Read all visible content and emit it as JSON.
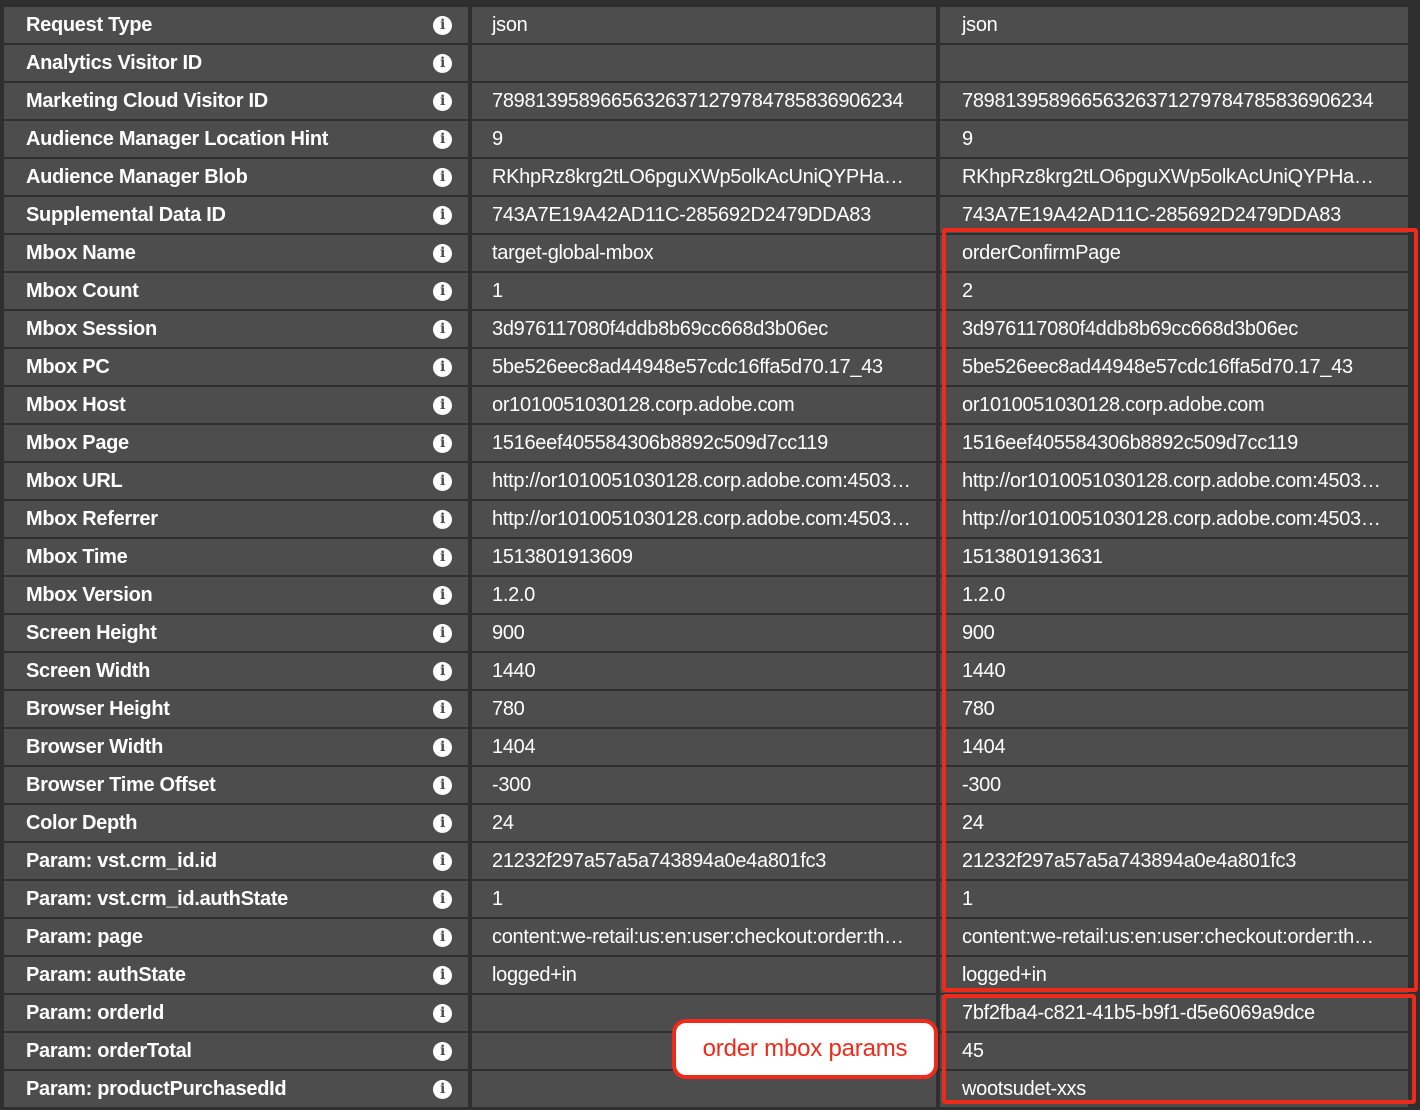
{
  "rows": [
    {
      "label": "Request Type",
      "value1": "json",
      "value2": "json"
    },
    {
      "label": "Analytics Visitor ID",
      "value1": "",
      "value2": ""
    },
    {
      "label": "Marketing Cloud Visitor ID",
      "value1": "78981395896656326371279784785836906234",
      "value2": "78981395896656326371279784785836906234"
    },
    {
      "label": "Audience Manager Location Hint",
      "value1": "9",
      "value2": "9"
    },
    {
      "label": "Audience Manager Blob",
      "value1": "RKhpRz8krg2tLO6pguXWp5olkAcUniQYPHa…",
      "value2": "RKhpRz8krg2tLO6pguXWp5olkAcUniQYPHa…"
    },
    {
      "label": "Supplemental Data ID",
      "value1": "743A7E19A42AD11C-285692D2479DDA83",
      "value2": "743A7E19A42AD11C-285692D2479DDA83"
    },
    {
      "label": "Mbox Name",
      "value1": "target-global-mbox",
      "value2": "orderConfirmPage"
    },
    {
      "label": "Mbox Count",
      "value1": "1",
      "value2": "2"
    },
    {
      "label": "Mbox Session",
      "value1": "3d976117080f4ddb8b69cc668d3b06ec",
      "value2": "3d976117080f4ddb8b69cc668d3b06ec"
    },
    {
      "label": "Mbox PC",
      "value1": "5be526eec8ad44948e57cdc16ffa5d70.17_43",
      "value2": "5be526eec8ad44948e57cdc16ffa5d70.17_43"
    },
    {
      "label": "Mbox Host",
      "value1": "or1010051030128.corp.adobe.com",
      "value2": "or1010051030128.corp.adobe.com"
    },
    {
      "label": "Mbox Page",
      "value1": "1516eef405584306b8892c509d7cc119",
      "value2": "1516eef405584306b8892c509d7cc119"
    },
    {
      "label": "Mbox URL",
      "value1": "http://or1010051030128.corp.adobe.com:4503…",
      "value2": "http://or1010051030128.corp.adobe.com:4503…"
    },
    {
      "label": "Mbox Referrer",
      "value1": "http://or1010051030128.corp.adobe.com:4503…",
      "value2": "http://or1010051030128.corp.adobe.com:4503…"
    },
    {
      "label": "Mbox Time",
      "value1": "1513801913609",
      "value2": "1513801913631"
    },
    {
      "label": "Mbox Version",
      "value1": "1.2.0",
      "value2": "1.2.0"
    },
    {
      "label": "Screen Height",
      "value1": "900",
      "value2": "900"
    },
    {
      "label": "Screen Width",
      "value1": "1440",
      "value2": "1440"
    },
    {
      "label": "Browser Height",
      "value1": "780",
      "value2": "780"
    },
    {
      "label": "Browser Width",
      "value1": "1404",
      "value2": "1404"
    },
    {
      "label": "Browser Time Offset",
      "value1": "-300",
      "value2": "-300"
    },
    {
      "label": "Color Depth",
      "value1": "24",
      "value2": "24"
    },
    {
      "label": "Param: vst.crm_id.id",
      "value1": "21232f297a57a5a743894a0e4a801fc3",
      "value2": "21232f297a57a5a743894a0e4a801fc3"
    },
    {
      "label": "Param: vst.crm_id.authState",
      "value1": "1",
      "value2": "1"
    },
    {
      "label": "Param: page",
      "value1": "content:we-retail:us:en:user:checkout:order:th…",
      "value2": "content:we-retail:us:en:user:checkout:order:th…"
    },
    {
      "label": "Param: authState",
      "value1": "logged+in",
      "value2": "logged+in"
    },
    {
      "label": "Param: orderId",
      "value1": "",
      "value2": "7bf2fba4-c821-41b5-b9f1-d5e6069a9dce"
    },
    {
      "label": "Param: orderTotal",
      "value1": "",
      "value2": "45"
    },
    {
      "label": "Param: productPurchasedId",
      "value1": "",
      "value2": "wootsudet-xxs"
    }
  ],
  "info_icon_glyph": "i",
  "callout_text": "order mbox params",
  "colors": {
    "cell_bg": "#4d4d4d",
    "grid_bg": "#2f2f2f",
    "text": "#ffffff",
    "highlight": "#f02a1a"
  }
}
